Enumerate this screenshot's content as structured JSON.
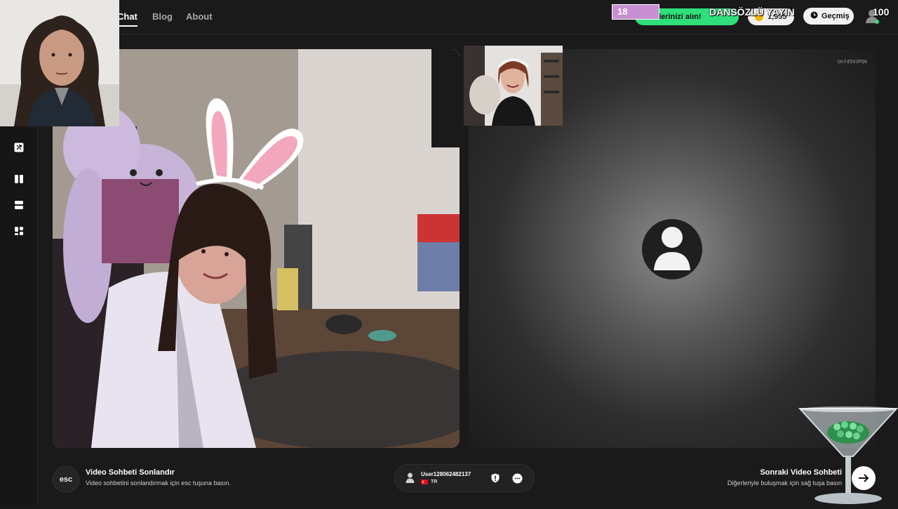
{
  "nav": {
    "chat": "Chat",
    "blog": "Blog",
    "about": "About"
  },
  "overlay": {
    "level": "18",
    "promo": "lerinizi alın!",
    "coins": "1,935",
    "stream_title": "DANSÖZLÜ YAYIN",
    "count": "100"
  },
  "history": {
    "label": "Geçmiş"
  },
  "sidebar": {
    "icons": [
      "shuffle-icon",
      "split-vertical-icon",
      "split-horizontal-icon",
      "grid-layout-icon"
    ]
  },
  "video": {
    "room_id": "Unfd593PQ8"
  },
  "bottom": {
    "esc_key": "esc",
    "end_title": "Video Sohbeti Sonlandır",
    "end_desc": "Video sohbetini sonlandırmak için esc tuşuna basın.",
    "next_title": "Sonraki Video Sohbeti",
    "next_desc": "Diğerleriyle buluşmak için sağ tuşa basın"
  },
  "peer": {
    "username": "User128062482137",
    "country": "TR"
  },
  "colors": {
    "accent_green": "#2fe07a",
    "level_badge": "#c98fd3",
    "background": "#1a1a1a"
  }
}
